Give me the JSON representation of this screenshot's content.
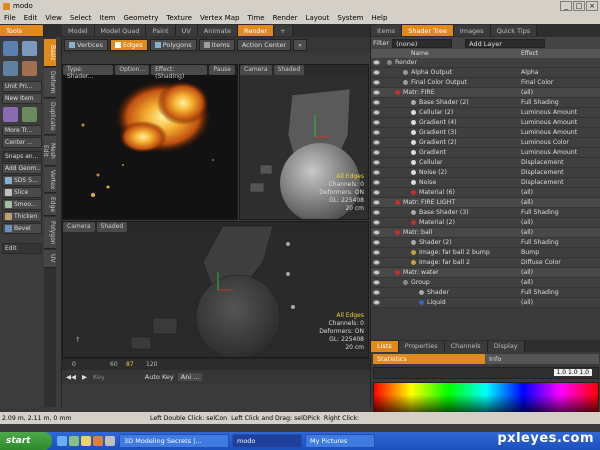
{
  "window": {
    "title": "modo"
  },
  "menu": [
    "File",
    "Edit",
    "View",
    "Select",
    "Item",
    "Geometry",
    "Texture",
    "Vertex Map",
    "Time",
    "Render",
    "Layout",
    "System",
    "Help"
  ],
  "top_tabs": [
    {
      "label": "Tools",
      "active": true
    },
    {
      "label": "Model",
      "active": false
    },
    {
      "label": "Model Quad",
      "active": false
    },
    {
      "label": "Paint",
      "active": false
    },
    {
      "label": "UV",
      "active": false
    },
    {
      "label": "Animate",
      "active": false
    },
    {
      "label": "Render",
      "active": true
    }
  ],
  "left_tools": {
    "unit": "Unit Pri...",
    "new_item": "New Item",
    "more": "More Tr...",
    "center": "Center ...",
    "snaps": "Snaps an...",
    "add_geom": "Add Geom...",
    "sds": "SDS S...",
    "slice": "Slice",
    "smooth": "Smoo...",
    "thicken": "Thicken",
    "bevel": "Bevel",
    "edit": "Edit"
  },
  "vertical_tabs": [
    "Basic",
    "Deform",
    "Duplicate",
    "Mesh Edit",
    "Vertex",
    "Edge",
    "Polygon",
    "UV"
  ],
  "selection_toolbar": {
    "vertices": "Vertices",
    "edges": "Edges",
    "polygons": "Polygons",
    "items": "Items",
    "action_center": "Action Center"
  },
  "viewports": {
    "render": {
      "labels": [
        "Type: Shader...",
        "Option...",
        "Effect: (Shading)",
        "Pause"
      ]
    },
    "camera_top": {
      "labels": [
        "Camera",
        "Shaded"
      ],
      "info": {
        "selection": "All Edges",
        "channels": "Channels: 0",
        "deformers": "Deformers: ON",
        "gl": "GL: 225408",
        "size": "20 cm"
      }
    },
    "camera_bottom": {
      "labels": [
        "Camera",
        "Shaded"
      ],
      "info": {
        "selection": "All Edges",
        "channels": "Channels: 0",
        "deformers": "Deformers: ON",
        "gl": "GL: 225408",
        "size": "20 cm"
      }
    }
  },
  "right_tabs": [
    {
      "label": "Items",
      "active": false
    },
    {
      "label": "Shader Tree",
      "active": true
    },
    {
      "label": "Images",
      "active": false
    },
    {
      "label": "Quick Tips",
      "active": false
    }
  ],
  "filter": {
    "label": "Filter",
    "value": "(none)",
    "add_layer": "Add Layer"
  },
  "shader_columns": {
    "name": "Name",
    "effect": "Effect"
  },
  "shader_rows": [
    {
      "name": "Render",
      "effect": "",
      "indent": 0,
      "color": "#888"
    },
    {
      "name": "Alpha Output",
      "effect": "Alpha",
      "indent": 2,
      "color": "#999"
    },
    {
      "name": "Final Color Output",
      "effect": "Final Color",
      "indent": 2,
      "color": "#999"
    },
    {
      "name": "Matr: FIRE",
      "effect": "(all)",
      "indent": 1,
      "color": "#c03030",
      "selected": true
    },
    {
      "name": "Base Shader (2)",
      "effect": "Full Shading",
      "indent": 3,
      "color": "#aaa"
    },
    {
      "name": "Cellular (2)",
      "effect": "Luminous Amount",
      "indent": 3,
      "color": "#ddd"
    },
    {
      "name": "Gradient (4)",
      "effect": "Luminous Amount",
      "indent": 3,
      "color": "#ddd"
    },
    {
      "name": "Gradient (3)",
      "effect": "Luminous Amount",
      "indent": 3,
      "color": "#ddd"
    },
    {
      "name": "Gradient (2)",
      "effect": "Luminous Color",
      "indent": 3,
      "color": "#ddd"
    },
    {
      "name": "Gradient",
      "effect": "Luminous Amount",
      "indent": 3,
      "color": "#ddd"
    },
    {
      "name": "Cellular",
      "effect": "Displacement",
      "indent": 3,
      "color": "#ddd"
    },
    {
      "name": "Noise (2)",
      "effect": "Displacement",
      "indent": 3,
      "color": "#ddd"
    },
    {
      "name": "Noise",
      "effect": "Displacement",
      "indent": 3,
      "color": "#ddd"
    },
    {
      "name": "Material (6)",
      "effect": "(all)",
      "indent": 3,
      "color": "#c03030"
    },
    {
      "name": "Matr: FIRE LIGHT",
      "effect": "(all)",
      "indent": 1,
      "color": "#c03030"
    },
    {
      "name": "Base Shader (3)",
      "effect": "Full Shading",
      "indent": 3,
      "color": "#aaa"
    },
    {
      "name": "Material (2)",
      "effect": "(all)",
      "indent": 3,
      "color": "#c03030"
    },
    {
      "name": "Matr: ball",
      "effect": "(all)",
      "indent": 1,
      "color": "#c03030"
    },
    {
      "name": "Shader (2)",
      "effect": "Full Shading",
      "indent": 3,
      "color": "#aaa"
    },
    {
      "name": "Image: far ball 2 bump",
      "effect": "Bump",
      "indent": 3,
      "color": "#c8a040"
    },
    {
      "name": "Image: far ball 2",
      "effect": "Diffuse Color",
      "indent": 3,
      "color": "#c8a040"
    },
    {
      "name": "Matr: water",
      "effect": "(all)",
      "indent": 1,
      "color": "#c03030"
    },
    {
      "name": "Group",
      "effect": "(all)",
      "indent": 2,
      "color": "#888"
    },
    {
      "name": "Shader",
      "effect": "Full Shading",
      "indent": 4,
      "color": "#aaa"
    },
    {
      "name": "Liquid",
      "effect": "(all)",
      "indent": 4,
      "color": "#4060c0"
    }
  ],
  "lower_tabs": [
    {
      "label": "Lists",
      "active": true
    },
    {
      "label": "Properties",
      "active": false
    },
    {
      "label": "Channels",
      "active": false
    },
    {
      "label": "Display",
      "active": false
    }
  ],
  "stats": {
    "statistics": "Statistics",
    "info": "Info",
    "slider_value": "1.0 1.0 1.0"
  },
  "timeline": {
    "ticks": [
      "0",
      "60",
      "87",
      "120"
    ]
  },
  "transport": {
    "key": "Key",
    "auto_key": "Auto Key",
    "ani": "Ani ..."
  },
  "status": {
    "coords": "2.09 m, 2.11 m, 0 mm",
    "hint1": "Left Double Click: selCon",
    "hint2": "Left Click and Drag: selDPick",
    "hint3": "Right Click:"
  },
  "taskbar": {
    "start": "start",
    "tasks": [
      {
        "label": "3D Modeling Secrets |...",
        "active": false
      },
      {
        "label": "modo",
        "active": true
      },
      {
        "label": "My Pictures",
        "active": false
      }
    ]
  },
  "watermark": "pxleyes.com",
  "colors": {
    "accent": "#e08a1e",
    "selected_row": "#6a6a6a",
    "fire": "#f0a020"
  }
}
